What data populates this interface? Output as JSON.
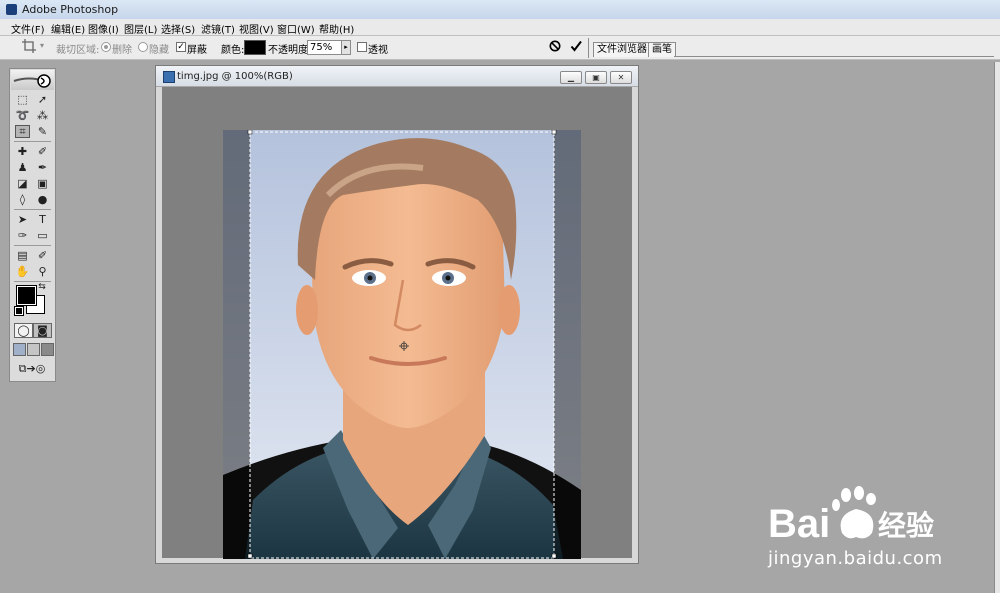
{
  "window": {
    "title": "Adobe Photoshop"
  },
  "menu": [
    "文件(F)",
    "编辑(E)",
    "图像(I)",
    "图层(L)",
    "选择(S)",
    "滤镜(T)",
    "视图(V)",
    "窗口(W)",
    "帮助(H)"
  ],
  "options_bar": {
    "crop_area_label": "裁切区域:",
    "delete_label": "删除",
    "hide_label": "隐藏",
    "shield_label": "屏蔽",
    "shield_checked": true,
    "color_label": "颜色:",
    "color_value": "#000000",
    "opacity_label": "不透明度:",
    "opacity_value": "75%",
    "perspective_label": "透视",
    "perspective_checked": false
  },
  "panel_tabs": [
    "文件浏览器",
    "画笔"
  ],
  "document": {
    "title": "timg.jpg @ 100%(RGB)"
  },
  "watermark": {
    "brand": "Bai",
    "brand_suffix": "经验",
    "url": "jingyan.baidu.com"
  },
  "colors": {
    "canvas_bg": "#808080",
    "workspace_bg": "#a6a6a6",
    "foreground": "#000000",
    "background": "#ffffff"
  }
}
